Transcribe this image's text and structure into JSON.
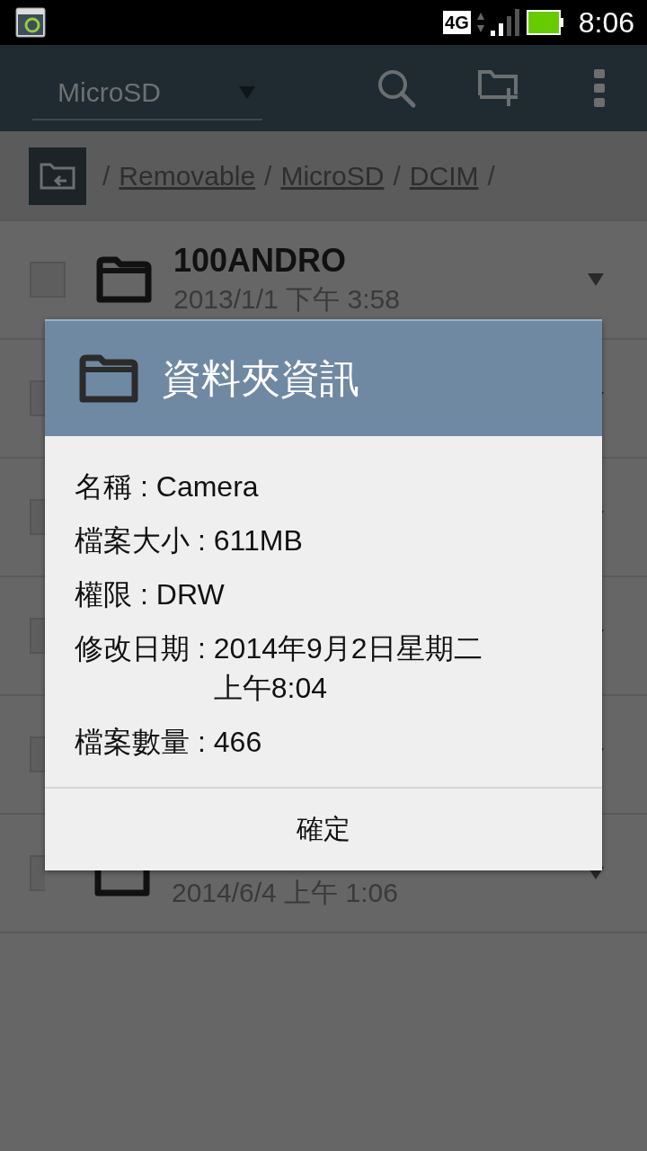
{
  "status_bar": {
    "network": "4G",
    "time": "8:06"
  },
  "toolbar": {
    "location": "MicroSD"
  },
  "breadcrumb": {
    "separator": "/",
    "parts": [
      "Removable",
      "MicroSD",
      "DCIM"
    ]
  },
  "rows": [
    {
      "name": "100ANDRO",
      "date": "2013/1/1 下午 3:58",
      "checked": false
    },
    {
      "checked": false
    },
    {
      "checked": false
    },
    {
      "checked": false
    },
    {
      "checked": false
    },
    {
      "date": "2014/6/4 上午 1:06",
      "checked": false
    }
  ],
  "dialog": {
    "title": "資料夾資訊",
    "fields": [
      {
        "label": "名稱 :",
        "value": "Camera"
      },
      {
        "label": "檔案大小 :",
        "value": "611MB"
      },
      {
        "label": "權限 :",
        "value": "DRW"
      },
      {
        "label": "修改日期 :",
        "value": "2014年9月2日星期二上午8:04"
      },
      {
        "label": "檔案數量 :",
        "value": "466"
      }
    ],
    "button": "確定"
  }
}
